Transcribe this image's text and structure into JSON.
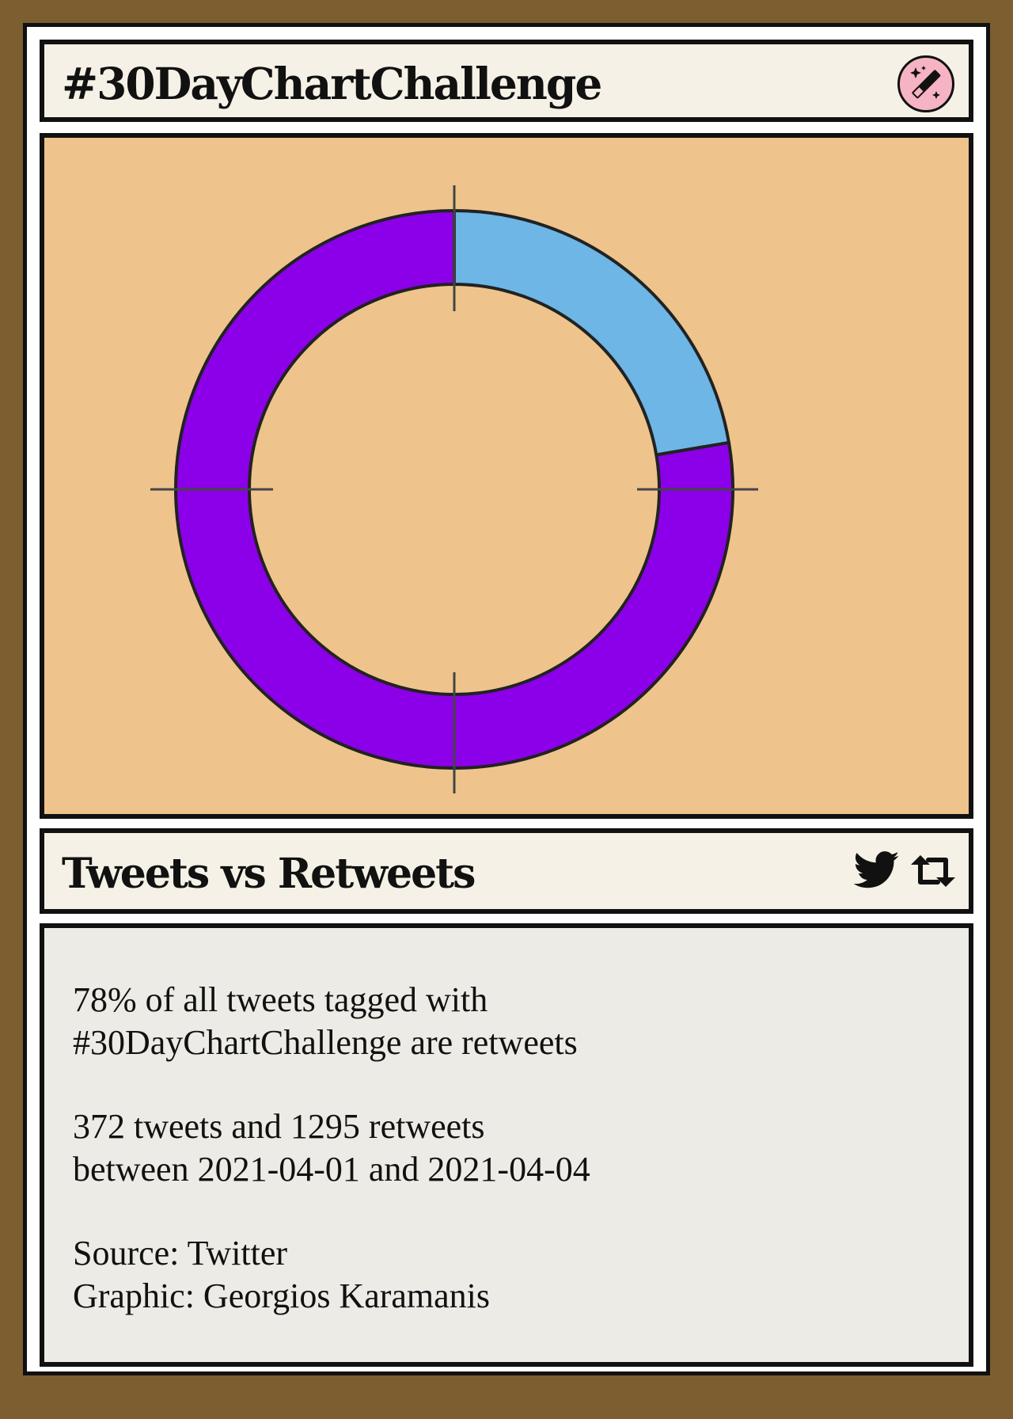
{
  "header": {
    "title": "#30DayChartChallenge",
    "badge_icon": "magic-wand-icon"
  },
  "chart_data": {
    "type": "pie",
    "variant": "donut",
    "slices": [
      {
        "label": "tweets",
        "value": 372,
        "color": "#6db6e6"
      },
      {
        "label": "retweets",
        "value": 1295,
        "color": "#8b00e8"
      }
    ],
    "start": "top",
    "direction": "clockwise",
    "background": "#eec48c"
  },
  "footer_bar": {
    "title": "Tweets vs Retweets",
    "icons": [
      "twitter-bird-icon",
      "retweet-icon"
    ]
  },
  "description": {
    "paragraph1": "78% of all tweets tagged with\n#30DayChartChallenge are retweets",
    "paragraph2": "372 tweets and 1295 retweets\nbetween 2021-04-01 and 2021-04-04",
    "paragraph3": "Source: Twitter\nGraphic: Georgios Karamanis"
  },
  "colors": {
    "frame": "#7c5e30",
    "header_bg": "#f5f1e6",
    "text_panel_bg": "#ecebe5",
    "badge_bg": "#f6b3c3"
  }
}
